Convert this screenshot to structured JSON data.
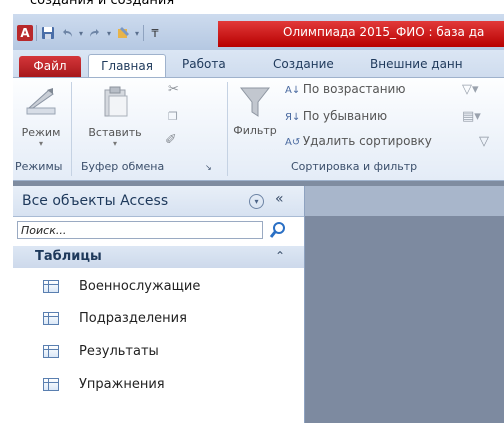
{
  "top_caption": "создания и создания",
  "window": {
    "title": "Олимпиада 2015_ФИО : база да",
    "app_icon_letter": "A"
  },
  "tabs": {
    "file": "Файл",
    "home": "Главная",
    "work": "Работа",
    "create": "Создание",
    "external": "Внешние данн"
  },
  "ribbon": {
    "mode_label": "Режим",
    "paste_label": "Вставить",
    "filter_label": "Фильтр",
    "sort_asc": "По возрастанию",
    "sort_desc": "По убыванию",
    "remove_sort": "Удалить сортировку",
    "group_modes": "Режимы",
    "group_clipboard": "Буфер обмена",
    "group_sort_filter": "Сортировка и фильтр"
  },
  "nav": {
    "title": "Все объекты Access",
    "search_placeholder": "Поиск...",
    "category": "Таблицы",
    "items": [
      {
        "label": "Военнослужащие",
        "icon": "table-icon"
      },
      {
        "label": "Подразделения",
        "icon": "table-icon"
      },
      {
        "label": "Результаты",
        "icon": "table-icon"
      },
      {
        "label": "Упражнения",
        "icon": "table-icon"
      }
    ]
  },
  "colors": {
    "title_bar_accent": "#c41e1e",
    "file_tab": "#c0282c",
    "ribbon_bg": "#e9f0f9"
  }
}
